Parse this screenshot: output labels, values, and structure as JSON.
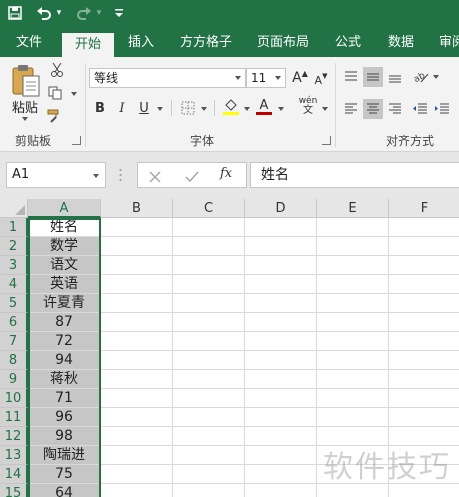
{
  "quick_access": {
    "undo_arrow": "▾",
    "customize": "▾"
  },
  "tabs": [
    "文件",
    "开始",
    "插入",
    "方方格子",
    "页面布局",
    "公式",
    "数据",
    "审阅"
  ],
  "active_tab": "开始",
  "clipboard": {
    "paste_label": "粘贴",
    "group_label": "剪贴板"
  },
  "font": {
    "family": "等线",
    "size": "11",
    "bold": "B",
    "italic": "I",
    "underline": "U",
    "increase": "A",
    "decrease": "A",
    "phonetic_top": "wén",
    "group_label": "字体"
  },
  "alignment": {
    "group_label": "对齐方式"
  },
  "formula_bar": {
    "name_box": "A1",
    "fx": "fx",
    "content": "姓名"
  },
  "columns": [
    "A",
    "B",
    "C",
    "D",
    "E",
    "F"
  ],
  "rows": [
    "1",
    "2",
    "3",
    "4",
    "5",
    "6",
    "7",
    "8",
    "9",
    "10",
    "11",
    "12",
    "13",
    "14",
    "15"
  ],
  "column_a": [
    "姓名",
    "数学",
    "语文",
    "英语",
    "许夏青",
    "87",
    "72",
    "94",
    "蒋秋",
    "71",
    "96",
    "98",
    "陶瑞进",
    "75",
    "64"
  ],
  "watermark": "软件技巧",
  "colors": {
    "accent": "#217346",
    "selection_fill": "#c6c6c6"
  }
}
